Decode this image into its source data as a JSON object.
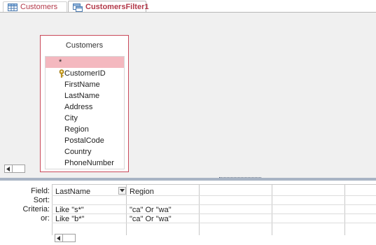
{
  "tabs": [
    {
      "label": "Customers",
      "icon": "table-icon",
      "active": false
    },
    {
      "label": "CustomersFilter1",
      "icon": "query-icon",
      "active": true
    }
  ],
  "field_list": {
    "title": "Customers",
    "fields": [
      "*",
      "CustomerID",
      "FirstName",
      "LastName",
      "Address",
      "City",
      "Region",
      "PostalCode",
      "Country",
      "PhoneNumber"
    ],
    "primary_key": "CustomerID"
  },
  "qbe": {
    "row_labels": {
      "field": "Field:",
      "sort": "Sort:",
      "criteria": "Criteria:",
      "or": "or:"
    },
    "columns": [
      {
        "field": "LastName",
        "sort": "",
        "criteria": "Like \"s*\"",
        "or": "Like \"b*\""
      },
      {
        "field": "Region",
        "sort": "",
        "criteria": "\"ca\" Or \"wa\"",
        "or": "\"ca\" Or \"wa\""
      }
    ]
  },
  "colors": {
    "accent": "#c9495a",
    "selected_row": "#f4b8bf",
    "pane_bg": "#f0f0f0"
  }
}
